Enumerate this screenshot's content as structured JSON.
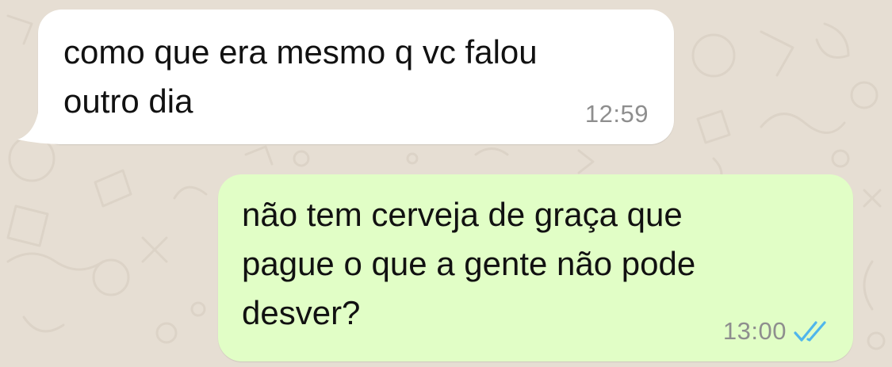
{
  "chat": {
    "messages": [
      {
        "direction": "incoming",
        "text": "como que era mesmo q vc falou\noutro dia",
        "time": "12:59"
      },
      {
        "direction": "outgoing",
        "text": "não tem cerveja de graça que\npague o que a gente não pode\ndesver?",
        "time": "13:00",
        "status_icon": "double-check-read-icon"
      }
    ]
  },
  "colors": {
    "wallpaper": "#e6ded3",
    "incoming_bubble": "#ffffff",
    "outgoing_bubble": "#e1fec6",
    "timestamp": "#8e8e8e",
    "read_check": "#4fb6ec"
  }
}
